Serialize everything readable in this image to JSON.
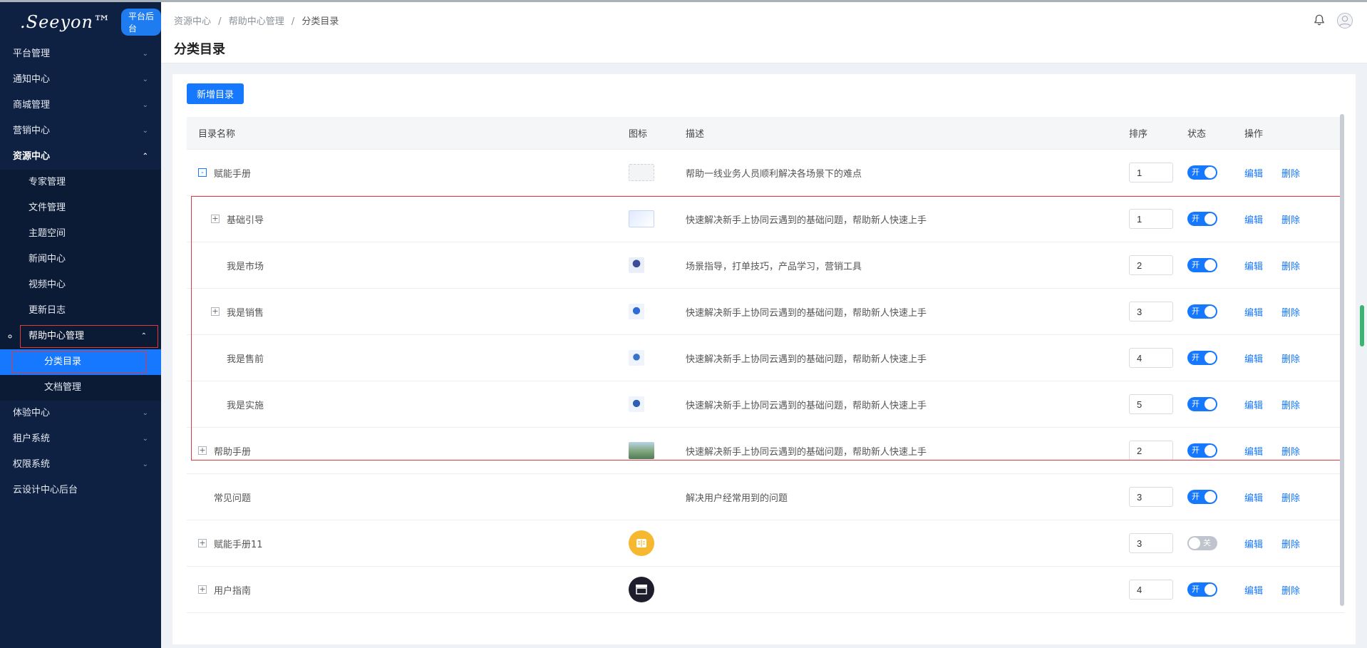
{
  "brand": {
    "logo_text": ".Seeyon™",
    "badge": "平台后台"
  },
  "sidebar": {
    "items": [
      {
        "label": "平台管理"
      },
      {
        "label": "通知中心"
      },
      {
        "label": "商城管理"
      },
      {
        "label": "营销中心"
      },
      {
        "label": "资源中心"
      },
      {
        "label": "专家管理"
      },
      {
        "label": "文件管理"
      },
      {
        "label": "主题空间"
      },
      {
        "label": "新闻中心"
      },
      {
        "label": "视频中心"
      },
      {
        "label": "更新日志"
      },
      {
        "label": "帮助中心管理"
      },
      {
        "label": "分类目录"
      },
      {
        "label": "文档管理"
      },
      {
        "label": "体验中心"
      },
      {
        "label": "租户系统"
      },
      {
        "label": "权限系统"
      },
      {
        "label": "云设计中心后台"
      }
    ]
  },
  "header": {
    "breadcrumb": [
      "资源中心",
      "/",
      "帮助中心管理",
      "/",
      "分类目录"
    ],
    "title": "分类目录"
  },
  "toolbar": {
    "add_label": "新增目录"
  },
  "table": {
    "columns": [
      "目录名称",
      "图标",
      "描述",
      "排序",
      "状态",
      "操作"
    ],
    "rows": [
      {
        "name": "赋能手册",
        "desc": "帮助一线业务人员顺利解决各场景下的难点",
        "sort": "1",
        "status": "开"
      },
      {
        "name": "基础引导",
        "desc": "快速解决新手上协同云遇到的基础问题，帮助新人快速上手",
        "sort": "1",
        "status": "开"
      },
      {
        "name": "我是市场",
        "desc": "场景指导，打单技巧，产品学习，营销工具",
        "sort": "2",
        "status": "开"
      },
      {
        "name": "我是销售",
        "desc": "快速解决新手上协同云遇到的基础问题，帮助新人快速上手",
        "sort": "3",
        "status": "开"
      },
      {
        "name": "我是售前",
        "desc": "快速解决新手上协同云遇到的基础问题，帮助新人快速上手",
        "sort": "4",
        "status": "开"
      },
      {
        "name": "我是实施",
        "desc": "快速解决新手上协同云遇到的基础问题，帮助新人快速上手",
        "sort": "5",
        "status": "开"
      },
      {
        "name": "帮助手册",
        "desc": "快速解决新手上协同云遇到的基础问题，帮助新人快速上手",
        "sort": "2",
        "status": "开"
      },
      {
        "name": "常见问题",
        "desc": "解决用户经常用到的问题",
        "sort": "3",
        "status": "开"
      },
      {
        "name": "赋能手册11",
        "desc": "",
        "sort": "3",
        "status": "关"
      },
      {
        "name": "用户指南",
        "desc": "",
        "sort": "4",
        "status": "开"
      }
    ],
    "actions": {
      "edit": "编辑",
      "delete": "删除"
    },
    "expand_plus": "+",
    "expand_minus": "-"
  },
  "colors": {
    "sidebar_bg": "#0e2143",
    "primary": "#1677ff",
    "highlight": "#e03b3b"
  }
}
